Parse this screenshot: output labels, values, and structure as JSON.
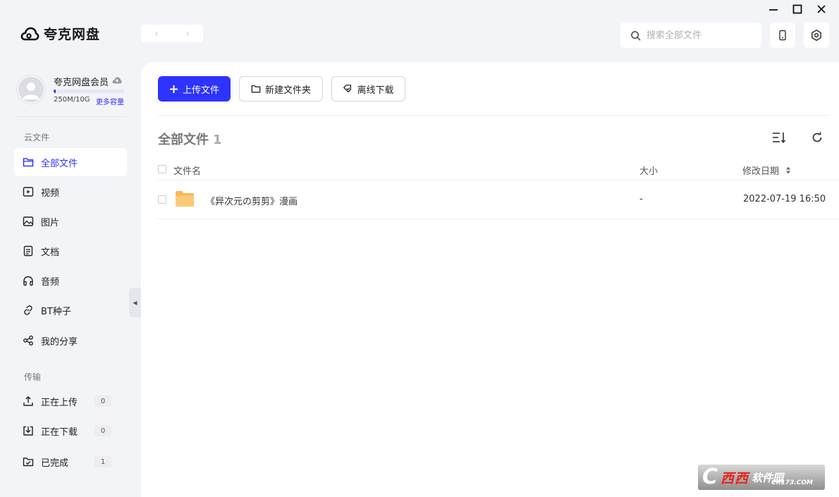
{
  "app": {
    "title": "夸克网盘"
  },
  "nav": {
    "back": "‹",
    "forward": "›"
  },
  "search": {
    "placeholder": "搜索全部文件"
  },
  "user": {
    "name": "夸克网盘会员",
    "quota": "250M/10G",
    "quota_used_fraction": 0.025,
    "more": "更多容量"
  },
  "sidebar": {
    "cloud_title": "云文件",
    "items": [
      {
        "label": "全部文件",
        "icon": "folder-icon"
      },
      {
        "label": "视频",
        "icon": "video-icon"
      },
      {
        "label": "图片",
        "icon": "image-icon"
      },
      {
        "label": "文档",
        "icon": "document-icon"
      },
      {
        "label": "音频",
        "icon": "headphones-icon"
      },
      {
        "label": "BT种子",
        "icon": "link-icon"
      },
      {
        "label": "我的分享",
        "icon": "share-icon"
      }
    ],
    "transfer_title": "传输",
    "transfer": [
      {
        "label": "正在上传",
        "count": "0",
        "icon": "upload-icon"
      },
      {
        "label": "正在下载",
        "count": "0",
        "icon": "download-icon"
      },
      {
        "label": "已完成",
        "count": "1",
        "icon": "completed-icon"
      }
    ]
  },
  "toolbar": {
    "upload": "上传文件",
    "new_folder": "新建文件夹",
    "offline": "离线下载"
  },
  "main": {
    "path": "全部文件",
    "count": "1",
    "columns": {
      "name": "文件名",
      "size": "大小",
      "date": "修改日期"
    },
    "files": [
      {
        "name": "《异次元の剪剪》漫画",
        "size": "-",
        "date": "2022-07-19 16:50"
      }
    ]
  },
  "watermark": {
    "main": "西西",
    "sub": "软件园",
    "url": "CR173.COM"
  },
  "colors": {
    "accent": "#2e33ff",
    "folder": "#fbc97a",
    "background": "#f3f4f8"
  }
}
